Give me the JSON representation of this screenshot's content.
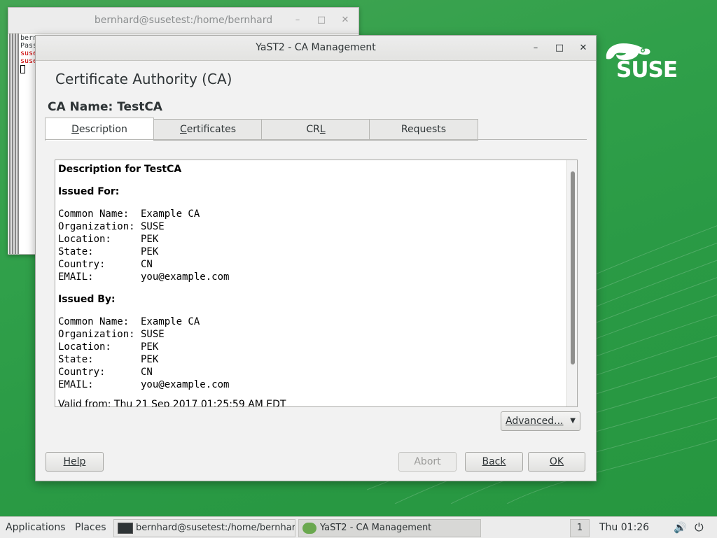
{
  "desktop": {
    "brand": "SUSE"
  },
  "terminal": {
    "title": "bernhard@susetest:/home/bernhard",
    "lines": [
      "bern",
      "Pass",
      "suse",
      "suse"
    ]
  },
  "dialog": {
    "title": "YaST2 - CA Management",
    "heading": "Certificate Authority (CA)",
    "ca_name": "CA Name: TestCA",
    "tabs": [
      {
        "label": "Description",
        "accel": "D",
        "rest": "escription",
        "active": true
      },
      {
        "label": "Certificates",
        "accel": "C",
        "rest": "ertificates",
        "active": false
      },
      {
        "label": "CRL",
        "accel": "L",
        "pre": "CR",
        "active": false
      },
      {
        "label": "Requests",
        "active": false
      }
    ],
    "description": {
      "title": "Description for TestCA",
      "issued_for_heading": "Issued For:",
      "issued_for": [
        "Common Name:  Example CA",
        "Organization: SUSE",
        "Location:     PEK",
        "State:        PEK",
        "Country:      CN",
        "EMAIL:        you@example.com"
      ],
      "issued_by_heading": "Issued By:",
      "issued_by": [
        "Common Name:  Example CA",
        "Organization: SUSE",
        "Location:     PEK",
        "State:        PEK",
        "Country:      CN",
        "EMAIL:        you@example.com"
      ],
      "valid_from": "Valid from: Thu 21 Sep 2017 01:25:59 AM EDT"
    },
    "buttons": {
      "advanced": "Advanced...",
      "help": "Help",
      "abort": "Abort",
      "back": "Back",
      "ok": "OK"
    }
  },
  "panel": {
    "applications": "Applications",
    "places": "Places",
    "tasks": [
      {
        "label": "bernhard@susetest:/home/bernhard",
        "active": false
      },
      {
        "label": "YaST2 - CA Management",
        "active": true
      }
    ],
    "workspace": "1",
    "clock": "Thu 01:26"
  }
}
